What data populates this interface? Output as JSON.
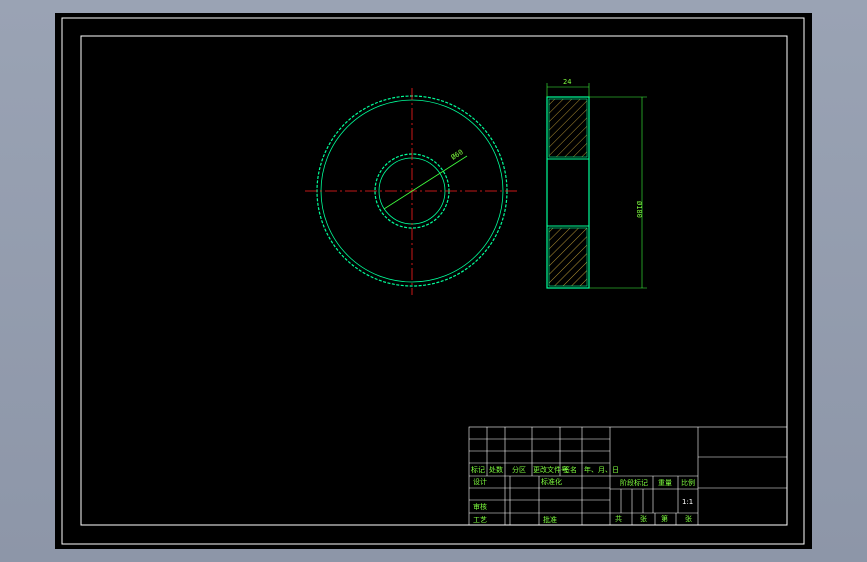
{
  "colors": {
    "background": "#000000",
    "frame": "#ffffff",
    "centerline": "#ff2020",
    "outline": "#00ff99",
    "dimension": "#3fff3f",
    "hatch": "#ffd24a",
    "text": "#7fff3f"
  },
  "dimensions": {
    "width": "24",
    "bore": "Ø60",
    "outer": "Ø180"
  },
  "title_block": {
    "change_row": [
      "标记",
      "处数",
      "分区",
      "更改文件号",
      "签名",
      "年、月、日"
    ],
    "design": "设计",
    "standardize": "标准化",
    "review": "审核",
    "process": "工艺",
    "approve": "批准",
    "stage_mark": "阶段标记",
    "weight": "重量",
    "scale": "比例",
    "scale_value": "1:1",
    "total": "共",
    "sheets": "张",
    "page": "第",
    "sheet_unit": "张"
  }
}
